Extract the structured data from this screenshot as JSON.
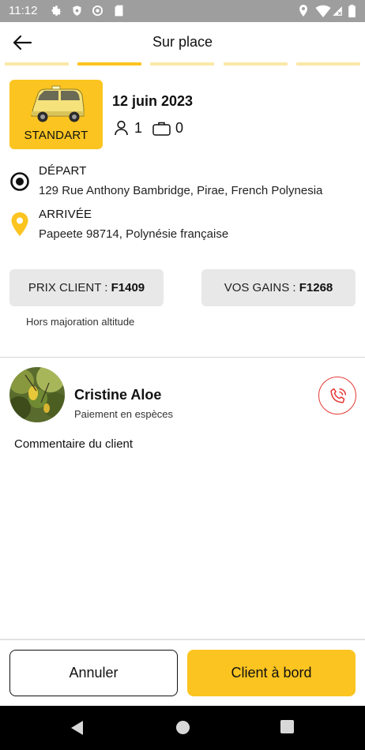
{
  "status_bar": {
    "time": "11:12",
    "left_icons": [
      "gear-icon",
      "shield-icon",
      "circle-a-icon",
      "sd-card-icon"
    ],
    "right_icons": [
      "location-icon",
      "wifi-icon",
      "signal-icon",
      "battery-icon"
    ]
  },
  "header": {
    "title": "Sur place",
    "back_icon": "arrow-left-icon"
  },
  "progress": {
    "total_steps": 5,
    "current_step": 2,
    "active_color": "#fbc420",
    "inactive_color": "#fbe7a7"
  },
  "ride": {
    "category": "STANDART",
    "date": "12 juin 2023",
    "passengers": "1",
    "luggage": "0"
  },
  "departure": {
    "title": "DÉPART",
    "address": "129 Rue Anthony Bambridge, Pirae, French Polynesia"
  },
  "arrival": {
    "title": "ARRIVÉE",
    "address": "Papeete 98714, Polynésie française"
  },
  "prices": {
    "client_label": "PRIX CLIENT : ",
    "client_value": "F1409",
    "gains_label": "VOS GAINS : ",
    "gains_value": "F1268",
    "note": "Hors majoration altitude"
  },
  "client": {
    "name": "Cristine Aloe",
    "payment": "Paiement en espèces",
    "comment_label": "Commentaire du client"
  },
  "actions": {
    "cancel": "Annuler",
    "board": "Client à bord"
  },
  "colors": {
    "accent": "#fbc420",
    "call": "#e53935",
    "pill_bg": "#e8e8e8"
  }
}
